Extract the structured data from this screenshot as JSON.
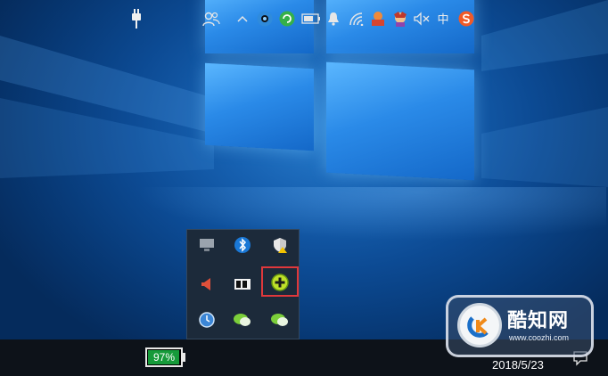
{
  "taskbar": {
    "battery_percent_label": "97%",
    "battery_level": 0.97,
    "ime_label": "中",
    "date": "2018/5/23"
  },
  "tray_popup": {
    "icons": [
      "display-icon",
      "bluetooth-icon",
      "security-shield-icon",
      "speaker-icon",
      "media-icon",
      "green-plus-icon",
      "clock-icon",
      "wechat-icon",
      "wechat-icon"
    ],
    "highlight_color": "#e0383b"
  },
  "watermark": {
    "brand": "酷知网",
    "url": "www.coozhi.com"
  },
  "colors": {
    "accent_blue": "#2a8ae8",
    "taskbar_bg": "#0d1219",
    "battery_green": "#169a3a"
  }
}
